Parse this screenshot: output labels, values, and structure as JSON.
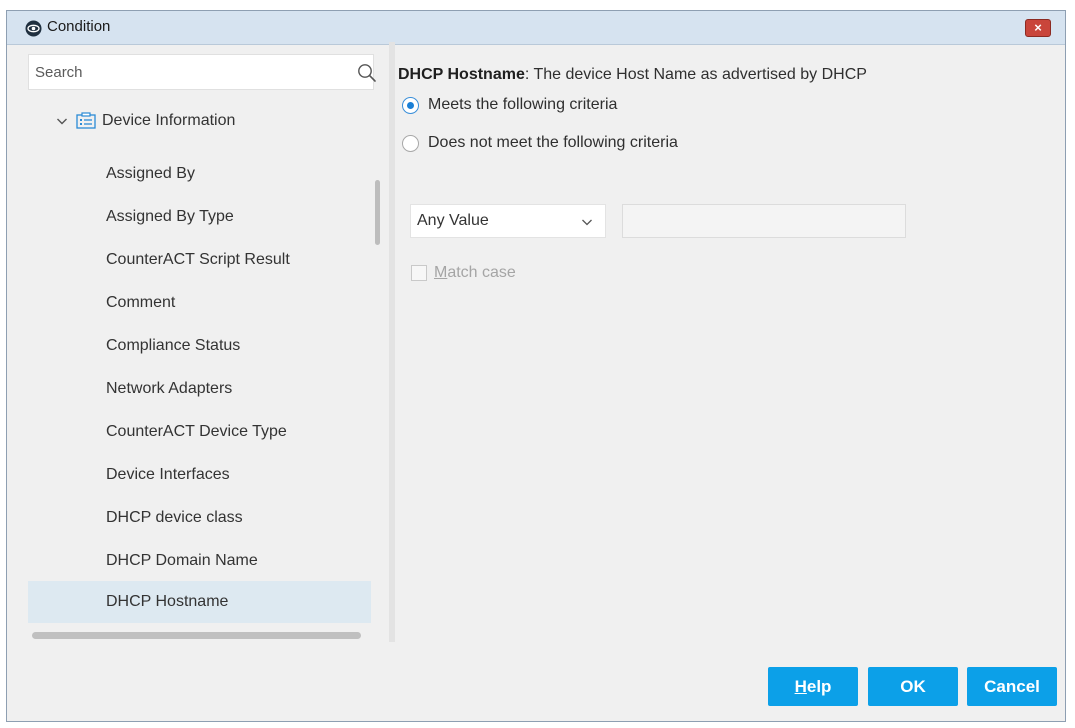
{
  "window": {
    "title": "Condition",
    "close_label": "×"
  },
  "search": {
    "placeholder": "Search"
  },
  "tree": {
    "group_label": "Device Information",
    "items": [
      {
        "label": "Assigned By"
      },
      {
        "label": "Assigned By Type"
      },
      {
        "label": "CounterACT Script Result"
      },
      {
        "label": "Comment"
      },
      {
        "label": "Compliance Status"
      },
      {
        "label": "Network Adapters"
      },
      {
        "label": "CounterACT Device Type"
      },
      {
        "label": "Device Interfaces"
      },
      {
        "label": "DHCP device class"
      },
      {
        "label": "DHCP Domain Name"
      },
      {
        "label": "DHCP Hostname",
        "selected": true
      }
    ]
  },
  "property": {
    "name": "DHCP Hostname",
    "description": ": The device Host Name as advertised by DHCP"
  },
  "criteria": {
    "meets_label": "Meets the following criteria",
    "not_meets_label": "Does not meet the following criteria",
    "selected": "meets"
  },
  "operator": {
    "selected": "Any Value"
  },
  "value_input": {
    "value": ""
  },
  "match_case": {
    "mnemonic": "M",
    "rest": "atch case",
    "checked": false,
    "enabled": false
  },
  "buttons": {
    "help_mnemonic": "H",
    "help_rest": "elp",
    "ok_label": "OK",
    "cancel_label": "Cancel"
  },
  "colors": {
    "accent_button": "#0ca0e8",
    "selected_row": "#dde9f1",
    "radio_selected": "#1a7fd6",
    "close_button": "#c9453b"
  }
}
